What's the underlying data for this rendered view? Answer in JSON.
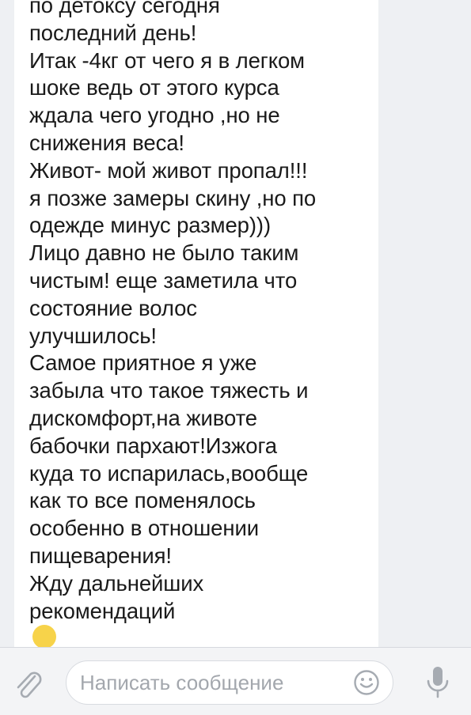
{
  "message": {
    "lines": [
      "по детоксу сегодня",
      "последний день!",
      "Итак -4кг от чего я в легком",
      "шоке ведь от этого курса",
      "ждала чего угодно ,но не",
      "снижения веса!",
      "Живот- мой живот пропал!!!",
      "я позже замеры скину ,но по",
      "одежде минус размер)))",
      "Лицо давно не было таким",
      "чистым! еще заметила что",
      "состояние волос",
      "улучшилось!",
      "Самое приятное я уже",
      "забыла что такое тяжесть и",
      "дискомфорт,на животе",
      "бабочки пархают!Изжога",
      "куда то испарилась,вообще",
      "как то все поменялось",
      "особенно в отношении",
      "пищеварения!",
      "Жду дальнейших",
      "рекомендаций"
    ],
    "trailing_emoji": "smiling-face-icon"
  },
  "composer": {
    "placeholder": "Написать сообщение",
    "value": "",
    "attach_icon": "paperclip-icon",
    "emoji_icon": "smiley-icon",
    "voice_icon": "microphone-icon"
  },
  "colors": {
    "background": "#eef0f3",
    "bubble": "#ffffff",
    "text": "#1a1a1a",
    "placeholder": "#a3a7ad",
    "icon": "#a6abb2"
  }
}
